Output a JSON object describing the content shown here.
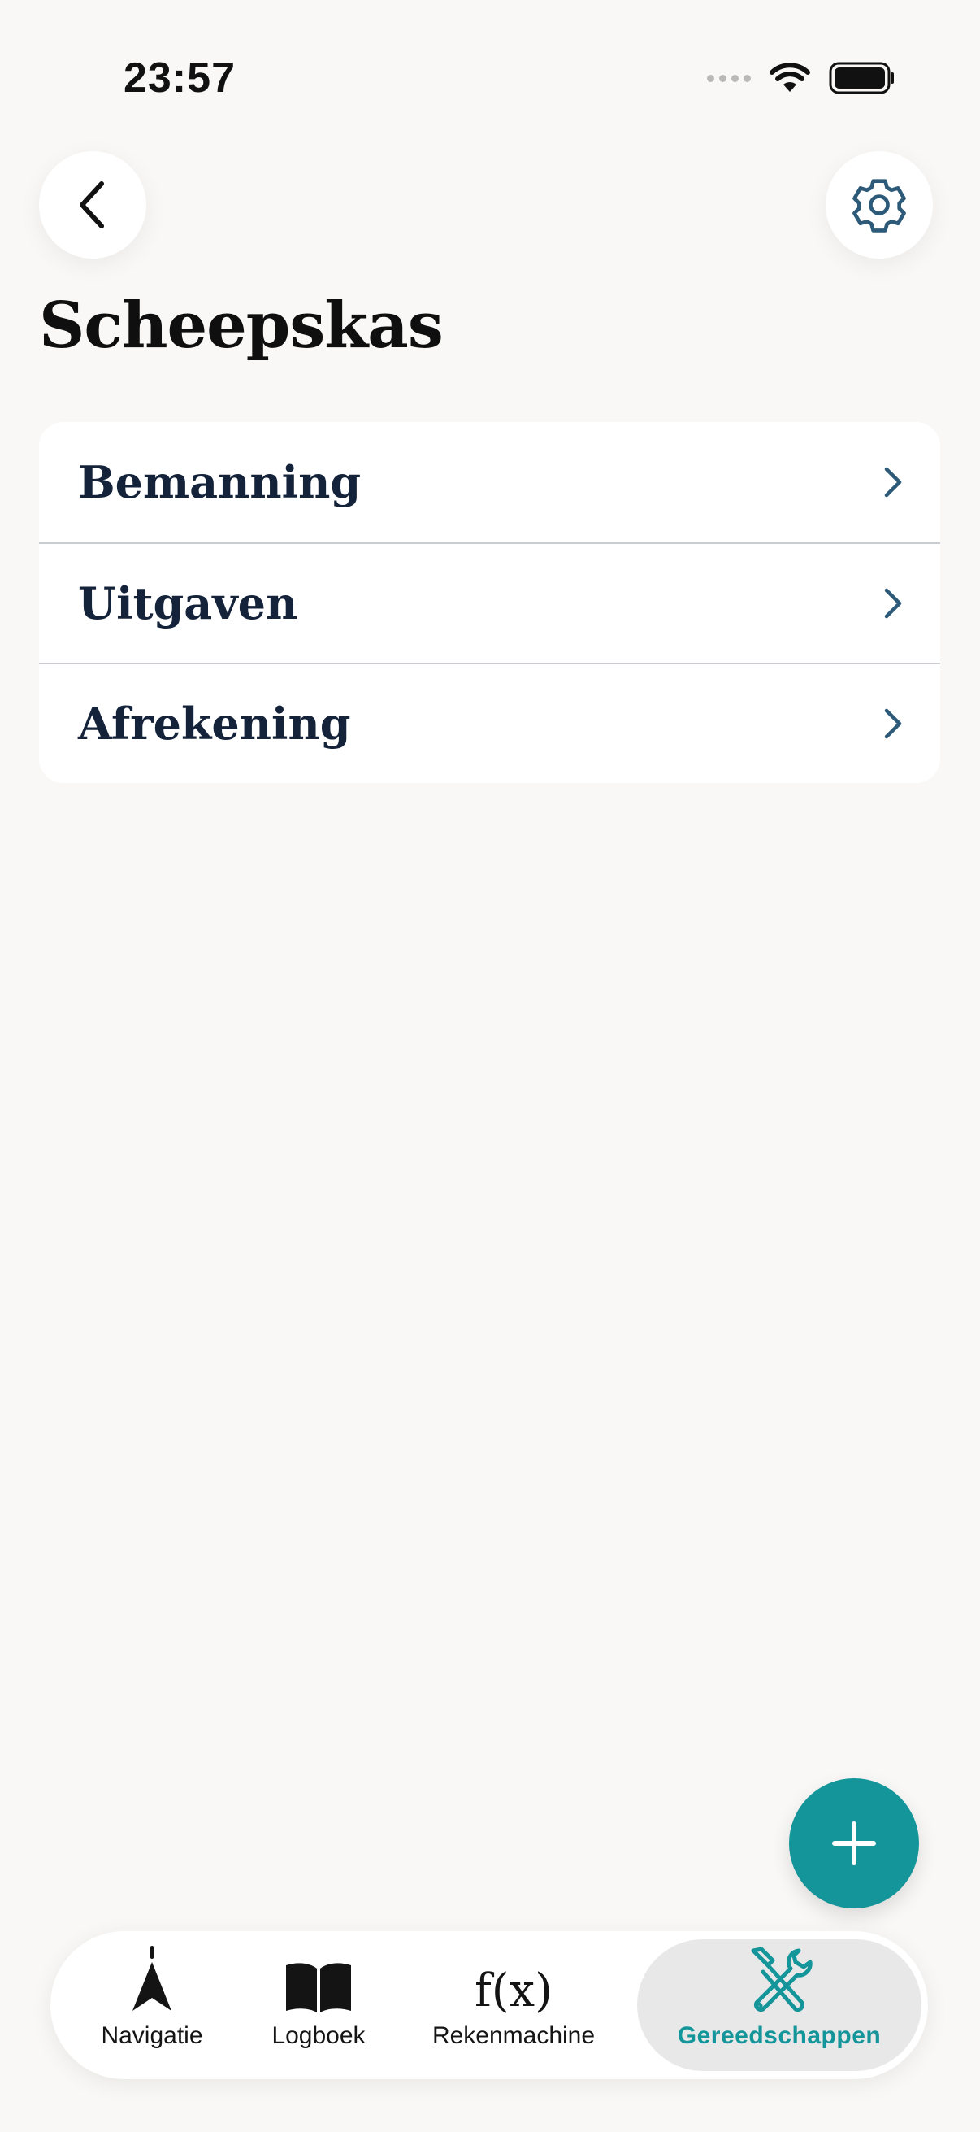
{
  "status_bar": {
    "time": "23:57"
  },
  "header": {
    "title": "Scheepskas"
  },
  "menu": {
    "items": [
      {
        "label": "Bemanning"
      },
      {
        "label": "Uitgaven"
      },
      {
        "label": "Afrekening"
      }
    ]
  },
  "tabbar": {
    "tabs": [
      {
        "label": "Navigatie",
        "icon": "navigation-arrow-icon"
      },
      {
        "label": "Logboek",
        "icon": "book-icon"
      },
      {
        "label": "Rekenmachine",
        "icon": "function-icon",
        "glyph": "f(x)"
      },
      {
        "label": "Gereedschappen",
        "icon": "tools-icon",
        "active": true
      }
    ]
  },
  "colors": {
    "accent": "#13959a",
    "background": "#f9f8f6",
    "row_text": "#14233a"
  }
}
